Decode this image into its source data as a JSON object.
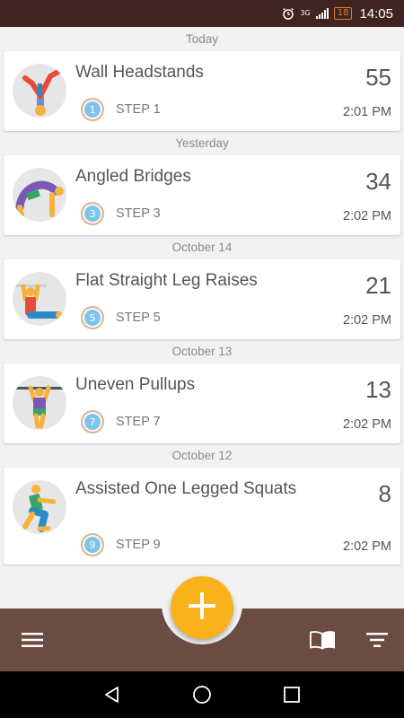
{
  "status_bar": {
    "network": "3G",
    "battery": "18",
    "time": "14:05",
    "icons": [
      "alarm-icon",
      "signal-icon",
      "battery-icon"
    ]
  },
  "days": [
    {
      "label": "Today",
      "entries": [
        {
          "exercise": "Wall Headstands",
          "step": "STEP 1",
          "step_number": "1",
          "reps": "55",
          "time": "2:01 PM",
          "icon": "headstand-figure-icon"
        }
      ]
    },
    {
      "label": "Yesterday",
      "entries": [
        {
          "exercise": "Angled Bridges",
          "step": "STEP 3",
          "step_number": "3",
          "reps": "34",
          "time": "2:02 PM",
          "icon": "bridge-figure-icon"
        }
      ]
    },
    {
      "label": "October 14",
      "entries": [
        {
          "exercise": "Flat Straight Leg Raises",
          "step": "STEP 5",
          "step_number": "5",
          "reps": "21",
          "time": "2:02 PM",
          "icon": "leg-raise-figure-icon"
        }
      ]
    },
    {
      "label": "October 13",
      "entries": [
        {
          "exercise": "Uneven Pullups",
          "step": "STEP 7",
          "step_number": "7",
          "reps": "13",
          "time": "2:02 PM",
          "icon": "pullup-figure-icon"
        }
      ]
    },
    {
      "label": "October 12",
      "entries": [
        {
          "exercise": "Assisted One Legged Squats",
          "step": "STEP 9",
          "step_number": "9",
          "reps": "8",
          "time": "2:02 PM",
          "icon": "squat-figure-icon"
        }
      ]
    }
  ],
  "bottom_bar": {
    "menu_icon": "hamburger-menu-icon",
    "fab_icon": "plus-icon",
    "book_icon": "book-icon",
    "filter_icon": "filter-icon"
  },
  "colors": {
    "status_bar": "#3f2421",
    "bottom_bar": "#6a4c42",
    "fab": "#f9b11c",
    "step_badge": "#7cc4ea"
  }
}
